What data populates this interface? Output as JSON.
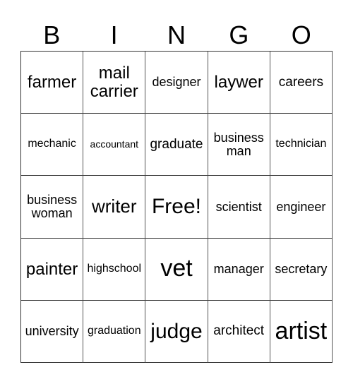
{
  "header": [
    "B",
    "I",
    "N",
    "G",
    "O"
  ],
  "cells": [
    [
      "farmer",
      "mail carrier",
      "designer",
      "laywer",
      "careers"
    ],
    [
      "mechanic",
      "accountant",
      "graduate",
      "business man",
      "technician"
    ],
    [
      "business woman",
      "writer",
      "Free!",
      "scientist",
      "engineer"
    ],
    [
      "painter",
      "highschool",
      "vet",
      "manager",
      "secretary"
    ],
    [
      "university",
      "graduation",
      "judge",
      "architect",
      "artist"
    ]
  ]
}
